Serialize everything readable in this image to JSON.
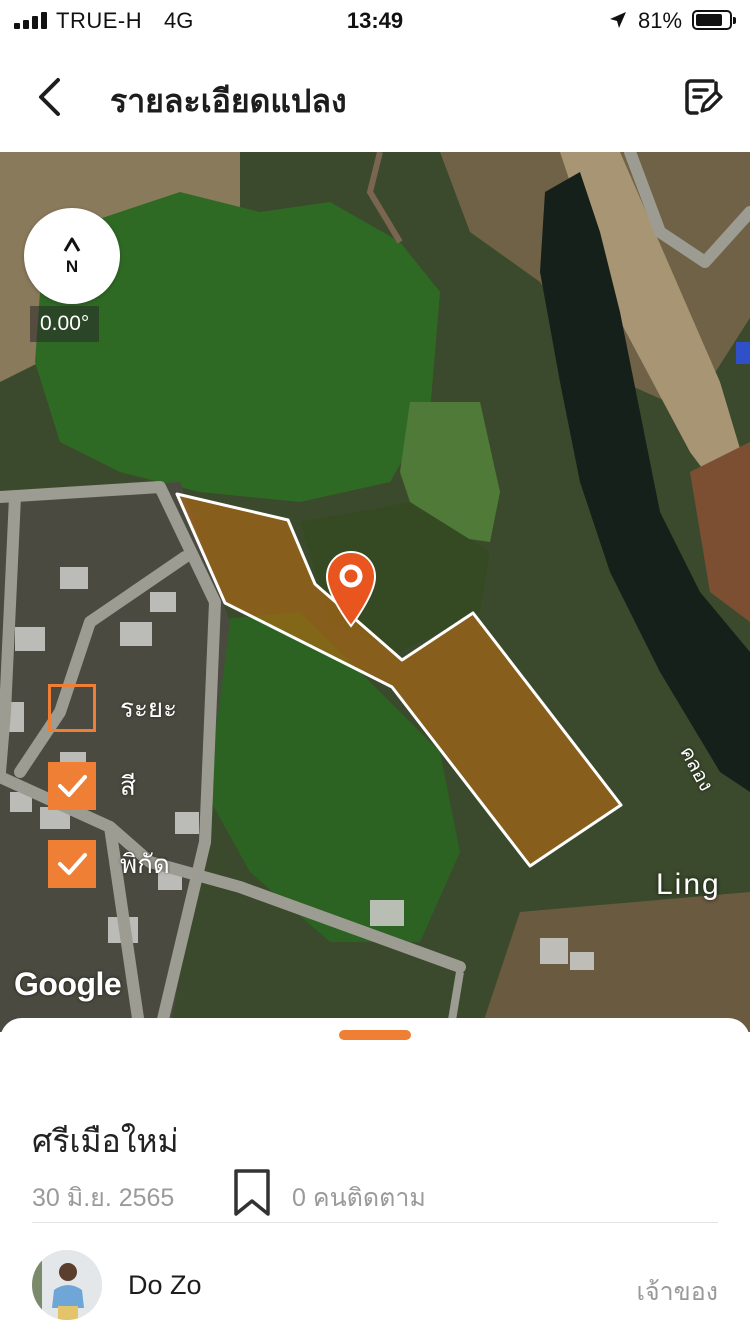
{
  "status_bar": {
    "carrier": "TRUE-H",
    "network": "4G",
    "time": "13:49",
    "battery": "81%",
    "battery_level": 0.81
  },
  "nav": {
    "title": "รายละเอียดแปลง",
    "back_icon": "chevron-left-icon",
    "edit_icon": "edit-note-icon"
  },
  "map": {
    "compass_letter": "N",
    "heading": "0.00°",
    "layers": [
      {
        "label": "ระยะ",
        "checked": false
      },
      {
        "label": "สี",
        "checked": true
      },
      {
        "label": "พิกัด",
        "checked": true
      }
    ],
    "place_label": "Ling",
    "canal_label": "คลอง",
    "attribution": "Google",
    "accent_color": "#ee7f35",
    "plot_fill_color": "#b86a14"
  },
  "sheet": {
    "plot_name": "ศรีเมือใหม่",
    "date": "30 มิ.ย. 2565",
    "followers": "0 คนติดตาม",
    "owner_name": "Do Zo",
    "owner_role": "เจ้าของ"
  }
}
